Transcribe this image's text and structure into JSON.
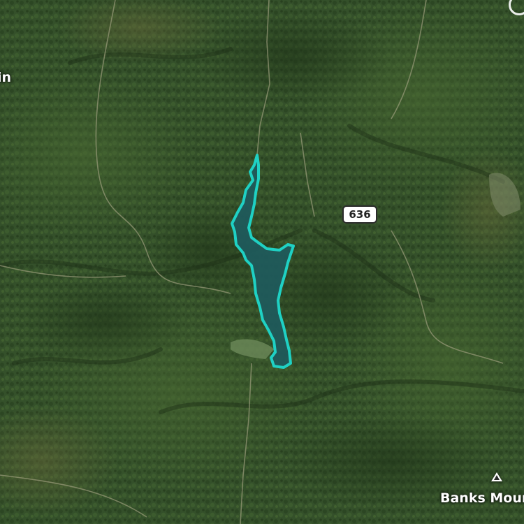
{
  "map": {
    "type": "satellite",
    "labels": {
      "left_place": "in",
      "peak_name": "Banks Moun"
    },
    "route_shield": "636",
    "lake": {
      "highlight_color": "#1fd1c4",
      "fill_color": "#1e5a5c"
    },
    "icons": [
      "mountain-peak-icon",
      "route-shield"
    ]
  }
}
